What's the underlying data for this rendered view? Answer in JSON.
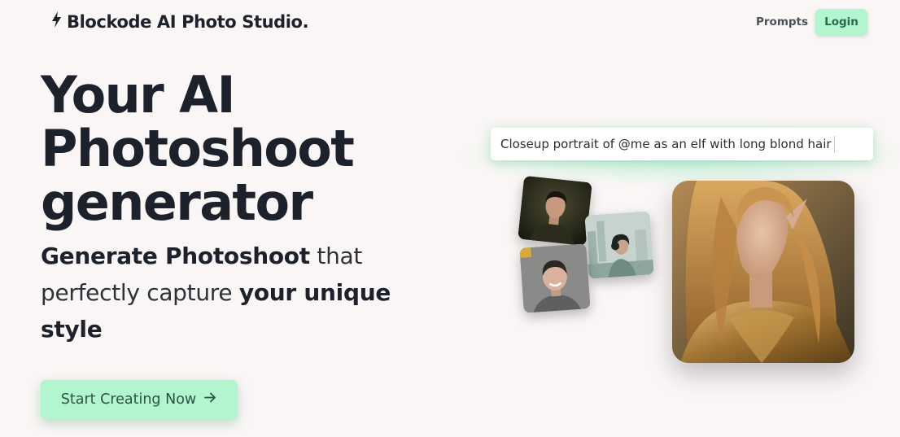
{
  "brand": {
    "name": "Blockode AI Photo Studio.",
    "icon": "lightning-bolt-icon"
  },
  "nav": {
    "prompts": "Prompts",
    "login": "Login"
  },
  "hero": {
    "title_lines": [
      "Your AI",
      "Photoshoot",
      "generator"
    ],
    "subtitle": {
      "bold_1": "Generate Photoshoot",
      "plain_1": " that perfectly capture ",
      "bold_2": "your unique style"
    },
    "cta": {
      "label": "Start Creating Now",
      "icon": "arrow-right-icon"
    }
  },
  "prompt": {
    "text": "Closeup portrait of @me as an elf with long blond hair"
  },
  "colors": {
    "background": "#f9f6f5",
    "accent": "#b2f5cf",
    "text": "#1c212c"
  }
}
